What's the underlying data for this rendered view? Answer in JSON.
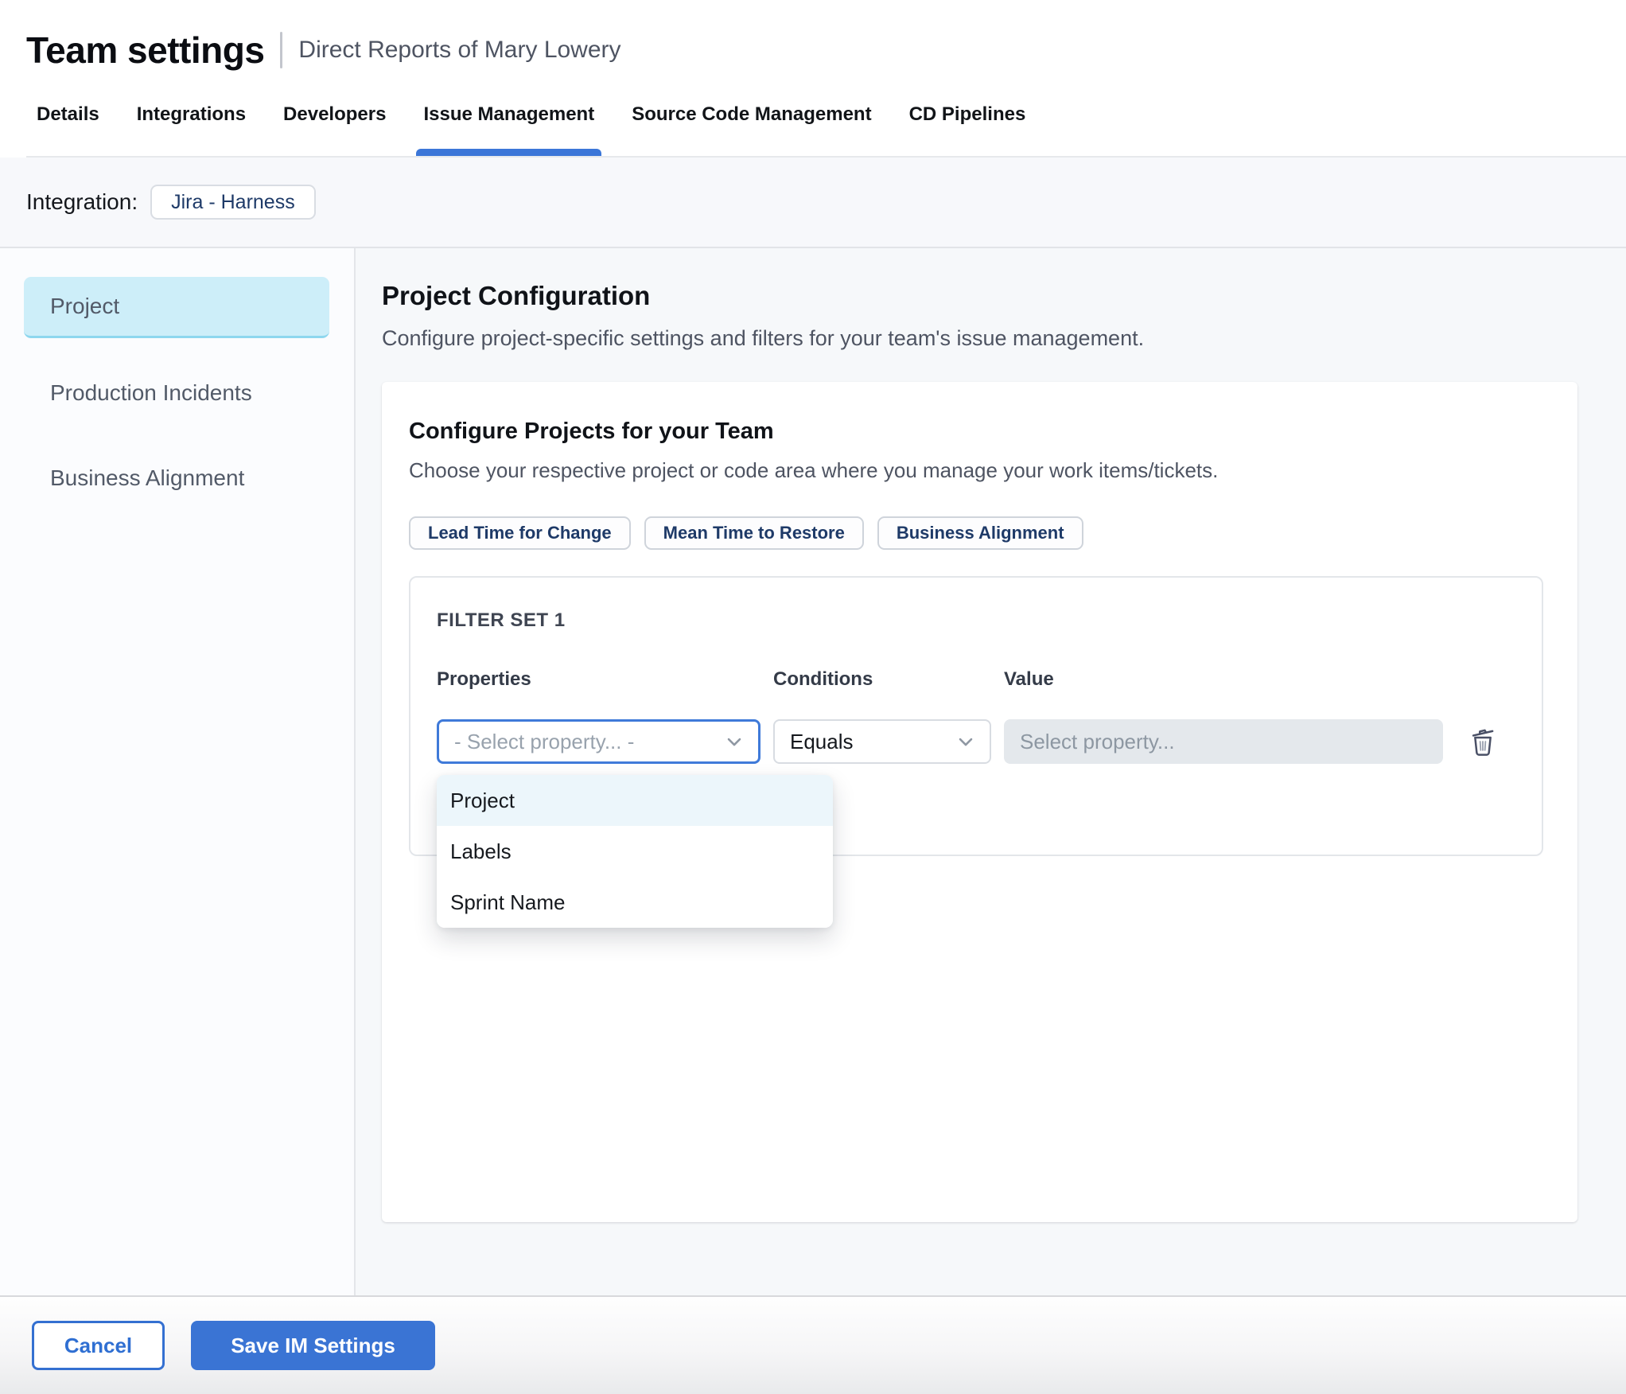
{
  "header": {
    "title": "Team settings",
    "subtitle": "Direct Reports of Mary Lowery"
  },
  "tabs": [
    {
      "label": "Details",
      "active": false
    },
    {
      "label": "Integrations",
      "active": false
    },
    {
      "label": "Developers",
      "active": false
    },
    {
      "label": "Issue Management",
      "active": true
    },
    {
      "label": "Source Code Management",
      "active": false
    },
    {
      "label": "CD Pipelines",
      "active": false
    }
  ],
  "integration": {
    "label": "Integration:",
    "chip": "Jira - Harness"
  },
  "sidebar": {
    "items": [
      {
        "label": "Project",
        "selected": true
      },
      {
        "label": "Production Incidents",
        "selected": false
      },
      {
        "label": "Business Alignment",
        "selected": false
      }
    ]
  },
  "main": {
    "title": "Project Configuration",
    "subtitle": "Configure project-specific settings and filters for your team's issue management.",
    "card": {
      "title": "Configure Projects for your Team",
      "subtitle": "Choose your respective project or code area where you manage your work items/tickets.",
      "pills": [
        "Lead Time for Change",
        "Mean Time to Restore",
        "Business Alignment"
      ],
      "filter_set": {
        "title": "FILTER SET 1",
        "columns": [
          "Properties",
          "Conditions",
          "Value"
        ],
        "property_select": {
          "placeholder": "- Select property... -"
        },
        "condition_select": {
          "value": "Equals"
        },
        "value_input": {
          "placeholder": "Select property..."
        },
        "dropdown": {
          "options": [
            "Project",
            "Labels",
            "Sprint Name"
          ],
          "highlighted": "Project"
        }
      }
    }
  },
  "footer": {
    "cancel_label": "Cancel",
    "save_label": "Save IM Settings"
  },
  "colors": {
    "accent_blue": "#3b76d8",
    "button_blue": "#3a74d4",
    "navy_text": "#1e3a68",
    "selected_item_bg": "#cdeef9",
    "selected_item_border": "#8ed7ee",
    "dropdown_highlight": "#ecf6fb",
    "disabled_input_bg": "#e4e8ec"
  }
}
